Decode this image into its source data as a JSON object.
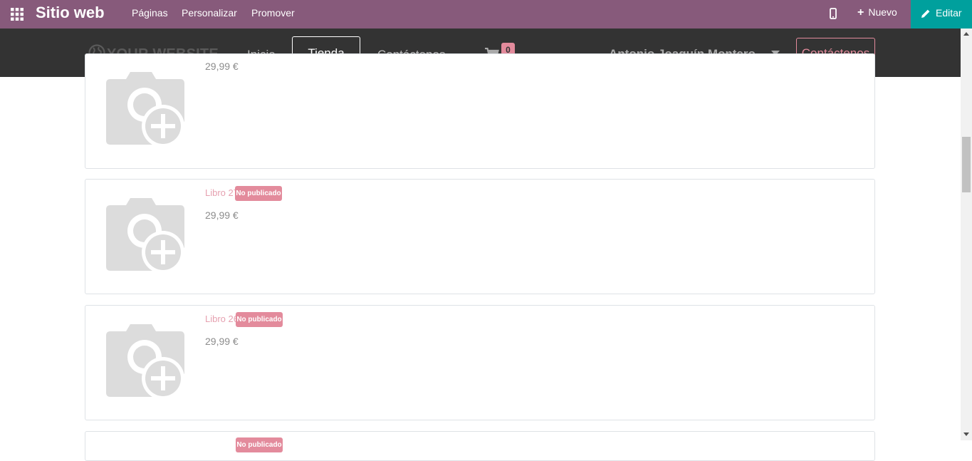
{
  "topbar": {
    "app_title": "Sitio web",
    "menu": [
      "Páginas",
      "Personalizar",
      "Promover"
    ],
    "new_label": "Nuevo",
    "edit_label": "Editar",
    "color": "#875a7b",
    "edit_color": "#00a09d"
  },
  "navbar": {
    "logo_text": "YOUR WEBSITE",
    "links": [
      "Inicio",
      "Tienda",
      "Contáctenos"
    ],
    "active_link": "Tienda",
    "cart_count": "0",
    "user_name": "Antonio Joaquín Montero...",
    "contact_button": "Contáctenos"
  },
  "products": [
    {
      "name": "",
      "badge": "",
      "price": "29,99 €"
    },
    {
      "name": "Libro 27",
      "badge": "No publicado",
      "price": "29,99 €"
    },
    {
      "name": "Libro 26",
      "badge": "No publicado",
      "price": "29,99 €"
    },
    {
      "name": "",
      "badge": "No publicado",
      "price": ""
    }
  ],
  "icons": {
    "apps": "grid-icon",
    "mobile": "mobile-icon",
    "new": "plus-icon",
    "edit": "pencil-icon",
    "logo": "globe-icon",
    "cart": "cart-icon",
    "user_menu": "caret-down-icon",
    "product_image": "camera-plus-icon"
  }
}
